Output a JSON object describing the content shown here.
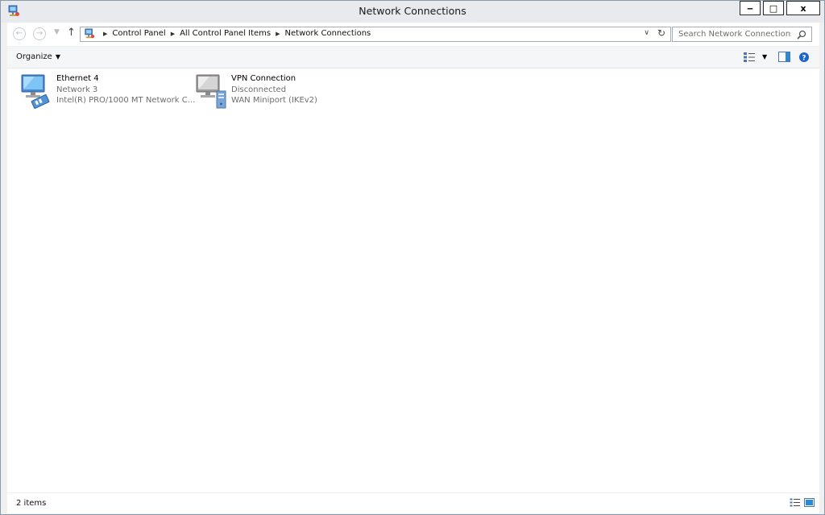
{
  "window": {
    "title": "Network Connections"
  },
  "caption": {
    "minimize": "‒",
    "maximize": "□",
    "close": "x"
  },
  "nav": {
    "up": "↑",
    "refresh": "↻"
  },
  "breadcrumb": [
    "Control Panel",
    "All Control Panel Items",
    "Network Connections"
  ],
  "search": {
    "placeholder": "Search Network Connections"
  },
  "toolbar": {
    "organize_label": "Organize"
  },
  "connections": [
    {
      "name": "Ethernet 4",
      "status": "Network  3",
      "device": "Intel(R) PRO/1000 MT Network C...",
      "icon": "ethernet-adapter-icon"
    },
    {
      "name": "VPN Connection",
      "status": "Disconnected",
      "device": "WAN Miniport (IKEv2)",
      "icon": "vpn-connection-icon"
    }
  ],
  "status": {
    "item_count": "2 items"
  },
  "colors": {
    "titlebar": "#e8eaed",
    "help": "#1b64c9",
    "pane_accent": "#2b8ad6"
  }
}
